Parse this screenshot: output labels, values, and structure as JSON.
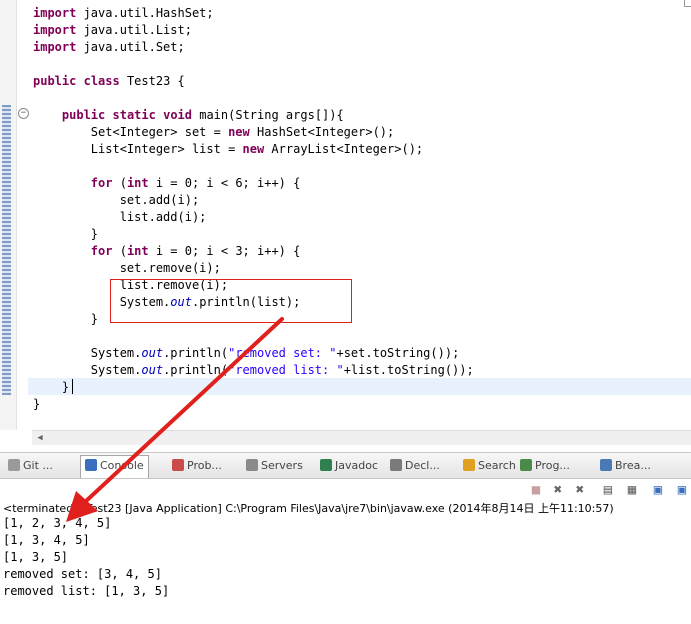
{
  "editor": {
    "lines": [
      {
        "parts": [
          {
            "t": "import",
            "c": "kw"
          },
          {
            "t": " java.util.HashSet;"
          }
        ]
      },
      {
        "parts": [
          {
            "t": "import",
            "c": "kw"
          },
          {
            "t": " java.util.List;"
          }
        ]
      },
      {
        "parts": [
          {
            "t": "import",
            "c": "kw"
          },
          {
            "t": " java.util.Set;"
          }
        ]
      },
      {
        "parts": []
      },
      {
        "parts": [
          {
            "t": "public",
            "c": "kw"
          },
          {
            "t": " "
          },
          {
            "t": "class",
            "c": "kw"
          },
          {
            "t": " Test23 {"
          }
        ]
      },
      {
        "parts": []
      },
      {
        "parts": [
          {
            "t": "    "
          },
          {
            "t": "public",
            "c": "kw"
          },
          {
            "t": " "
          },
          {
            "t": "static",
            "c": "kw"
          },
          {
            "t": " "
          },
          {
            "t": "void",
            "c": "kw"
          },
          {
            "t": " main(String args[]){"
          }
        ]
      },
      {
        "parts": [
          {
            "t": "        Set<Integer> set = "
          },
          {
            "t": "new",
            "c": "kw"
          },
          {
            "t": " HashSet<Integer>();"
          }
        ]
      },
      {
        "parts": [
          {
            "t": "        List<Integer> list = "
          },
          {
            "t": "new",
            "c": "kw"
          },
          {
            "t": " ArrayList<Integer>();"
          }
        ]
      },
      {
        "parts": []
      },
      {
        "parts": [
          {
            "t": "        "
          },
          {
            "t": "for",
            "c": "kw"
          },
          {
            "t": " ("
          },
          {
            "t": "int",
            "c": "kw"
          },
          {
            "t": " i = 0; i < 6; i++) {"
          }
        ]
      },
      {
        "parts": [
          {
            "t": "            set.add(i);"
          }
        ]
      },
      {
        "parts": [
          {
            "t": "            list.add(i);"
          }
        ]
      },
      {
        "parts": [
          {
            "t": "        }"
          }
        ]
      },
      {
        "parts": [
          {
            "t": "        "
          },
          {
            "t": "for",
            "c": "kw"
          },
          {
            "t": " ("
          },
          {
            "t": "int",
            "c": "kw"
          },
          {
            "t": " i = 0; i < 3; i++) {"
          }
        ]
      },
      {
        "parts": [
          {
            "t": "            set.remove(i);"
          }
        ]
      },
      {
        "parts": [
          {
            "t": "            list.remove(i);"
          }
        ]
      },
      {
        "parts": [
          {
            "t": "            System."
          },
          {
            "t": "out",
            "c": "fld"
          },
          {
            "t": ".println(list);"
          }
        ]
      },
      {
        "parts": [
          {
            "t": "        }"
          }
        ]
      },
      {
        "parts": []
      },
      {
        "parts": [
          {
            "t": "        System."
          },
          {
            "t": "out",
            "c": "fld"
          },
          {
            "t": ".println("
          },
          {
            "t": "\"removed set: \"",
            "c": "str"
          },
          {
            "t": "+set.toString());"
          }
        ]
      },
      {
        "parts": [
          {
            "t": "        System."
          },
          {
            "t": "out",
            "c": "fld"
          },
          {
            "t": ".println("
          },
          {
            "t": "\"removed list: \"",
            "c": "str"
          },
          {
            "t": "+list.toString());"
          }
        ]
      },
      {
        "parts": [
          {
            "t": "    }"
          }
        ]
      },
      {
        "parts": [
          {
            "t": "}"
          }
        ]
      }
    ]
  },
  "console": {
    "tabs": [
      {
        "label": "Git ...",
        "icon": "git-icon"
      },
      {
        "label": "Console",
        "icon": "console-icon",
        "active": true
      },
      {
        "label": "Prob...",
        "icon": "problems-icon"
      },
      {
        "label": "Servers",
        "icon": "servers-icon"
      },
      {
        "label": "Javadoc",
        "icon": "javadoc-icon"
      },
      {
        "label": "Decl...",
        "icon": "declaration-icon"
      },
      {
        "label": "Search",
        "icon": "search-icon"
      },
      {
        "label": "Prog...",
        "icon": "progress-icon"
      },
      {
        "label": "Brea...",
        "icon": "breakpoints-icon"
      }
    ],
    "status": "<terminated> Test23 [Java Application] C:\\Program Files\\Java\\jre7\\bin\\javaw.exe (2014年8月14日 上午11:10:57)",
    "output": [
      "[1, 2, 3, 4, 5]",
      "[1, 3, 4, 5]",
      "[1, 3, 5]",
      "removed set: [3, 4, 5]",
      "removed list: [1, 3, 5]"
    ]
  },
  "colors": {
    "keyword": "#7f0055",
    "field": "#0000c0",
    "string": "#2a00ff",
    "annotation": "#e0201c"
  }
}
